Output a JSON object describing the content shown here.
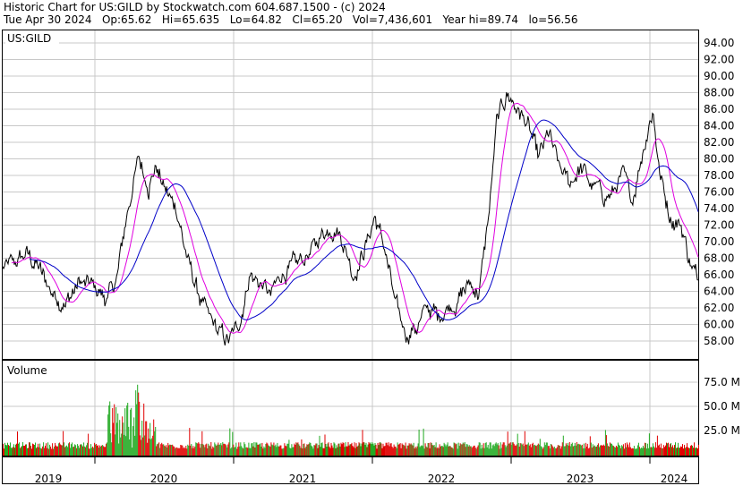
{
  "header": {
    "line1": "Historic Chart for US:GILD by Stockwatch.com 604.687.1500 - (c) 2024",
    "line2": "Tue Apr 30 2024   Op:65.62   Hi=65.635   Lo=64.82   Cl=65.20   Vol=7,436,601   Year hi=89.74   lo=56.56"
  },
  "chart_data": [
    {
      "type": "line",
      "panel_label": "US:GILD",
      "ylim": [
        56,
        95
      ],
      "y_ticks": [
        "58.00",
        "60.00",
        "62.00",
        "64.00",
        "66.00",
        "68.00",
        "70.00",
        "72.00",
        "74.00",
        "76.00",
        "78.00",
        "80.00",
        "82.00",
        "84.00",
        "86.00",
        "88.00",
        "90.00",
        "92.00",
        "94.00"
      ],
      "x_ticks": [
        "2019",
        "2020",
        "2021",
        "2022",
        "2023",
        "2024"
      ],
      "grid": true,
      "price_path": [
        {
          "t": 0.0,
          "v": 66.5
        },
        {
          "t": 0.02,
          "v": 67.5
        },
        {
          "t": 0.035,
          "v": 68.5
        },
        {
          "t": 0.05,
          "v": 67
        },
        {
          "t": 0.07,
          "v": 64
        },
        {
          "t": 0.09,
          "v": 62.5
        },
        {
          "t": 0.11,
          "v": 65
        },
        {
          "t": 0.13,
          "v": 64.5
        },
        {
          "t": 0.15,
          "v": 63
        },
        {
          "t": 0.165,
          "v": 66
        },
        {
          "t": 0.18,
          "v": 74
        },
        {
          "t": 0.195,
          "v": 80
        },
        {
          "t": 0.21,
          "v": 77
        },
        {
          "t": 0.22,
          "v": 79
        },
        {
          "t": 0.235,
          "v": 76
        },
        {
          "t": 0.25,
          "v": 74
        },
        {
          "t": 0.265,
          "v": 68
        },
        {
          "t": 0.28,
          "v": 64
        },
        {
          "t": 0.295,
          "v": 61
        },
        {
          "t": 0.31,
          "v": 59
        },
        {
          "t": 0.325,
          "v": 58
        },
        {
          "t": 0.34,
          "v": 60
        },
        {
          "t": 0.355,
          "v": 66
        },
        {
          "t": 0.37,
          "v": 65
        },
        {
          "t": 0.385,
          "v": 63.5
        },
        {
          "t": 0.4,
          "v": 66
        },
        {
          "t": 0.42,
          "v": 67
        },
        {
          "t": 0.44,
          "v": 68.5
        },
        {
          "t": 0.46,
          "v": 71
        },
        {
          "t": 0.475,
          "v": 72
        },
        {
          "t": 0.49,
          "v": 70
        },
        {
          "t": 0.505,
          "v": 66
        },
        {
          "t": 0.52,
          "v": 69
        },
        {
          "t": 0.535,
          "v": 73
        },
        {
          "t": 0.55,
          "v": 69
        },
        {
          "t": 0.565,
          "v": 62
        },
        {
          "t": 0.58,
          "v": 59
        },
        {
          "t": 0.595,
          "v": 59.5
        },
        {
          "t": 0.61,
          "v": 62
        },
        {
          "t": 0.625,
          "v": 61
        },
        {
          "t": 0.64,
          "v": 62
        },
        {
          "t": 0.655,
          "v": 63
        },
        {
          "t": 0.67,
          "v": 65
        },
        {
          "t": 0.685,
          "v": 64
        },
        {
          "t": 0.7,
          "v": 74
        },
        {
          "t": 0.71,
          "v": 84
        },
        {
          "t": 0.725,
          "v": 88
        },
        {
          "t": 0.74,
          "v": 86
        },
        {
          "t": 0.755,
          "v": 84
        },
        {
          "t": 0.77,
          "v": 80
        },
        {
          "t": 0.785,
          "v": 83
        },
        {
          "t": 0.8,
          "v": 79
        },
        {
          "t": 0.815,
          "v": 77
        },
        {
          "t": 0.83,
          "v": 79
        },
        {
          "t": 0.845,
          "v": 77
        },
        {
          "t": 0.86,
          "v": 76
        },
        {
          "t": 0.875,
          "v": 75.5
        },
        {
          "t": 0.89,
          "v": 78
        },
        {
          "t": 0.905,
          "v": 75
        },
        {
          "t": 0.92,
          "v": 81
        },
        {
          "t": 0.935,
          "v": 86
        },
        {
          "t": 0.945,
          "v": 78
        },
        {
          "t": 0.96,
          "v": 73
        },
        {
          "t": 0.975,
          "v": 72
        },
        {
          "t": 0.99,
          "v": 67
        },
        {
          "t": 1.0,
          "v": 65.2
        }
      ]
    },
    {
      "type": "bar",
      "panel_label": "Volume",
      "ylim": [
        0,
        100
      ],
      "y_ticks": [
        "25.0 M",
        "50.0 M",
        "75.0 M"
      ],
      "grid": true
    }
  ],
  "colors": {
    "price": "#000000",
    "ma_short": "#e000e0",
    "ma_long": "#0000c8",
    "vol_up": "#22aa22",
    "vol_down": "#e00000",
    "grid": "#c8c8c8"
  }
}
